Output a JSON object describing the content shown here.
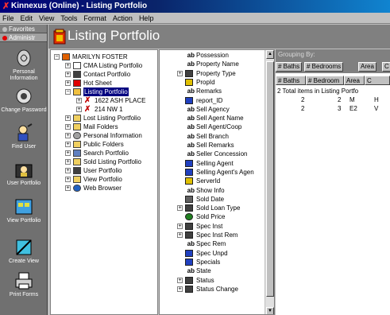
{
  "window": {
    "title": "Kinnexus (Online) - Listing Portfolio"
  },
  "menu": [
    "File",
    "Edit",
    "View",
    "Tools",
    "Format",
    "Action",
    "Help"
  ],
  "leftbar": {
    "tabs": [
      "Favorites",
      "Administr"
    ],
    "items": [
      {
        "label": "Personal Information",
        "icon": "personal-info-icon"
      },
      {
        "label": "Change Password",
        "icon": "change-password-icon"
      },
      {
        "label": "Find User",
        "icon": "find-user-icon"
      },
      {
        "label": "User Portfolio",
        "icon": "user-portfolio-icon"
      },
      {
        "label": "View Portfolio",
        "icon": "view-portfolio-icon"
      },
      {
        "label": "Create View",
        "icon": "create-view-icon"
      },
      {
        "label": "Print Forms",
        "icon": "print-forms-icon"
      }
    ]
  },
  "header": {
    "title": "Listing Portfolio"
  },
  "tree": {
    "items": [
      {
        "label": "MARILYN FOSTER",
        "level": 0,
        "pm": "−",
        "icon": "house-icon"
      },
      {
        "label": "CMA Listing Portfolio",
        "level": 1,
        "pm": "+",
        "icon": "document-icon"
      },
      {
        "label": "Contact Portfolio",
        "level": 1,
        "pm": "+",
        "icon": "contact-icon"
      },
      {
        "label": "Hot Sheet",
        "level": 1,
        "pm": "+",
        "icon": "hot-sheet-icon"
      },
      {
        "label": "Listing Portfolio",
        "level": 1,
        "pm": "−",
        "icon": "folder-open-icon",
        "selected": true
      },
      {
        "label": "1622 ASH PLACE",
        "level": 2,
        "pm": "+",
        "icon": "listing-x-icon"
      },
      {
        "label": "214 NW 1",
        "level": 2,
        "pm": "+",
        "icon": "listing-x-icon"
      },
      {
        "label": "Lost Listing Portfolio",
        "level": 1,
        "pm": "+",
        "icon": "folder-icon"
      },
      {
        "label": "Mail Folders",
        "level": 1,
        "pm": "+",
        "icon": "folder-icon"
      },
      {
        "label": "Personal Information",
        "level": 1,
        "pm": "+",
        "icon": "personal-info-icon"
      },
      {
        "label": "Public Folders",
        "level": 1,
        "pm": "+",
        "icon": "folder-icon"
      },
      {
        "label": "Search Portfolio",
        "level": 1,
        "pm": "+",
        "icon": "search-icon"
      },
      {
        "label": "Sold Listing Portfolio",
        "level": 1,
        "pm": "+",
        "icon": "folder-icon"
      },
      {
        "label": "User Portfolio",
        "level": 1,
        "pm": "+",
        "icon": "user-icon"
      },
      {
        "label": "View Portfolio",
        "level": 1,
        "pm": "+",
        "icon": "folder-icon"
      },
      {
        "label": "Web Browser",
        "level": 1,
        "pm": "+",
        "icon": "globe-icon"
      }
    ]
  },
  "fields": {
    "items": [
      {
        "type": "ab",
        "label": "Possession"
      },
      {
        "type": "ab",
        "label": "Property Name"
      },
      {
        "type": "list",
        "label": "Property Type",
        "pm": "+"
      },
      {
        "type": "key",
        "label": "PropId"
      },
      {
        "type": "ab",
        "label": "Remarks"
      },
      {
        "type": "person",
        "label": "report_ID"
      },
      {
        "type": "ab",
        "label": "Sell Agency"
      },
      {
        "type": "ab",
        "label": "Sell Agent Name"
      },
      {
        "type": "ab",
        "label": "Sell Agent/Coop"
      },
      {
        "type": "ab",
        "label": "Sell Branch"
      },
      {
        "type": "ab",
        "label": "Sell Remarks"
      },
      {
        "type": "ab",
        "label": "Seller Concession"
      },
      {
        "type": "person",
        "label": "Selling Agent"
      },
      {
        "type": "person",
        "label": "Selling Agent's Agen"
      },
      {
        "type": "key",
        "label": "ServerId"
      },
      {
        "type": "ab",
        "label": "Show Info"
      },
      {
        "type": "date",
        "label": "Sold Date"
      },
      {
        "type": "list",
        "label": "Sold Loan Type",
        "pm": "+"
      },
      {
        "type": "money",
        "label": "Sold Price"
      },
      {
        "type": "list",
        "label": "Spec Inst",
        "pm": "+"
      },
      {
        "type": "list",
        "label": "Spec Inst Rem",
        "pm": "+"
      },
      {
        "type": "ab",
        "label": "Spec Rem"
      },
      {
        "type": "person",
        "label": "Spec Unpd"
      },
      {
        "type": "person",
        "label": "Specials"
      },
      {
        "type": "ab",
        "label": "State"
      },
      {
        "type": "list",
        "label": "Status",
        "pm": "+"
      },
      {
        "type": "list",
        "label": "Status Change",
        "pm": "+"
      }
    ]
  },
  "grid": {
    "groupby_label": "Grouping By:",
    "chips": [
      "# Baths",
      "# Bedrooms",
      "Area",
      "C"
    ],
    "headers": [
      "# Baths",
      "# Bedroom",
      "Area",
      "C"
    ],
    "total_text": "2 Total items in Listing Portfo",
    "rows": [
      [
        "2",
        "2",
        "M",
        "H"
      ],
      [
        "2",
        "3",
        "E2",
        "V"
      ]
    ]
  },
  "colors": {
    "title_start": "#00007b",
    "title_end": "#1084d0",
    "selection": "#000080",
    "panel": "#808080"
  }
}
